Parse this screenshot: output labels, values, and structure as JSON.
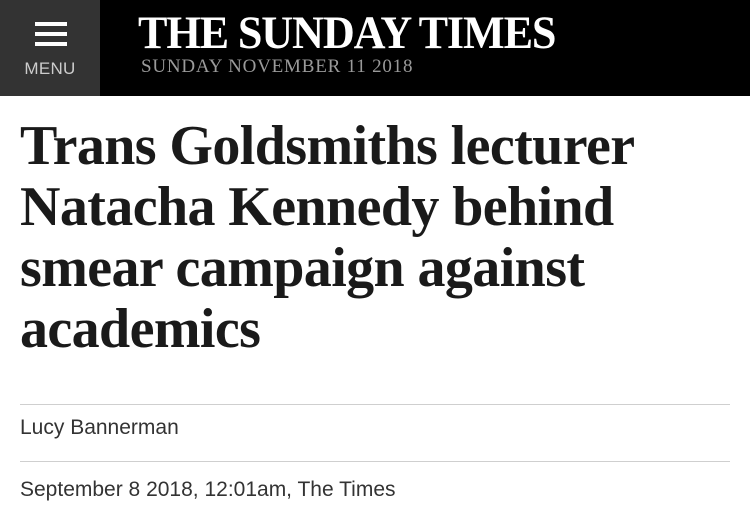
{
  "header": {
    "menu_label": "MENU",
    "masthead": "THE SUNDAY TIMES",
    "edition_date": "SUNDAY NOVEMBER 11 2018",
    "background_color": "#000000",
    "menu_background_color": "#333333"
  },
  "article": {
    "headline": "Trans Goldsmiths lecturer Natacha Kennedy behind smear campaign against academics",
    "author": "Lucy Bannerman",
    "published": "September 8 2018, 12:01am, The Times"
  }
}
